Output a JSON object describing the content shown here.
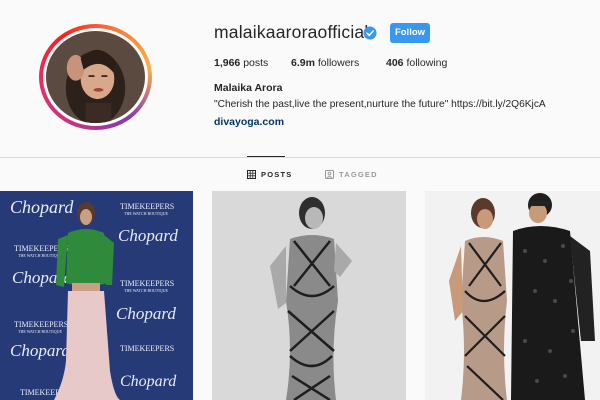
{
  "profile": {
    "username": "malaikaaroraofficial",
    "follow_label": "Follow",
    "posts_count": "1,966",
    "posts_label": "posts",
    "followers_count": "6.9m",
    "followers_label": "followers",
    "following_count": "406",
    "following_label": "following",
    "full_name": "Malaika Arora",
    "bio": "\"Cherish the past,live the present,nurture the future\" https://bit.ly/2Q6KjcA",
    "website": "divayoga.com"
  },
  "tabs": [
    {
      "label": "POSTS",
      "active": true
    },
    {
      "label": "TAGGED",
      "active": false
    }
  ],
  "colors": {
    "follow_button": "#3897f0",
    "verified_badge": "#3897f0",
    "website_link": "#003569"
  },
  "posts": [
    {
      "description": "Woman in green top and pink skirt at Chopard event",
      "backdrop_text": [
        "Chopard",
        "TIMEKEEPERS",
        "THE WATCH BOUTIQUE"
      ]
    },
    {
      "description": "Black and white photo of woman in caged dress"
    },
    {
      "description": "Woman in caged dress with man in sequined jacket"
    }
  ]
}
